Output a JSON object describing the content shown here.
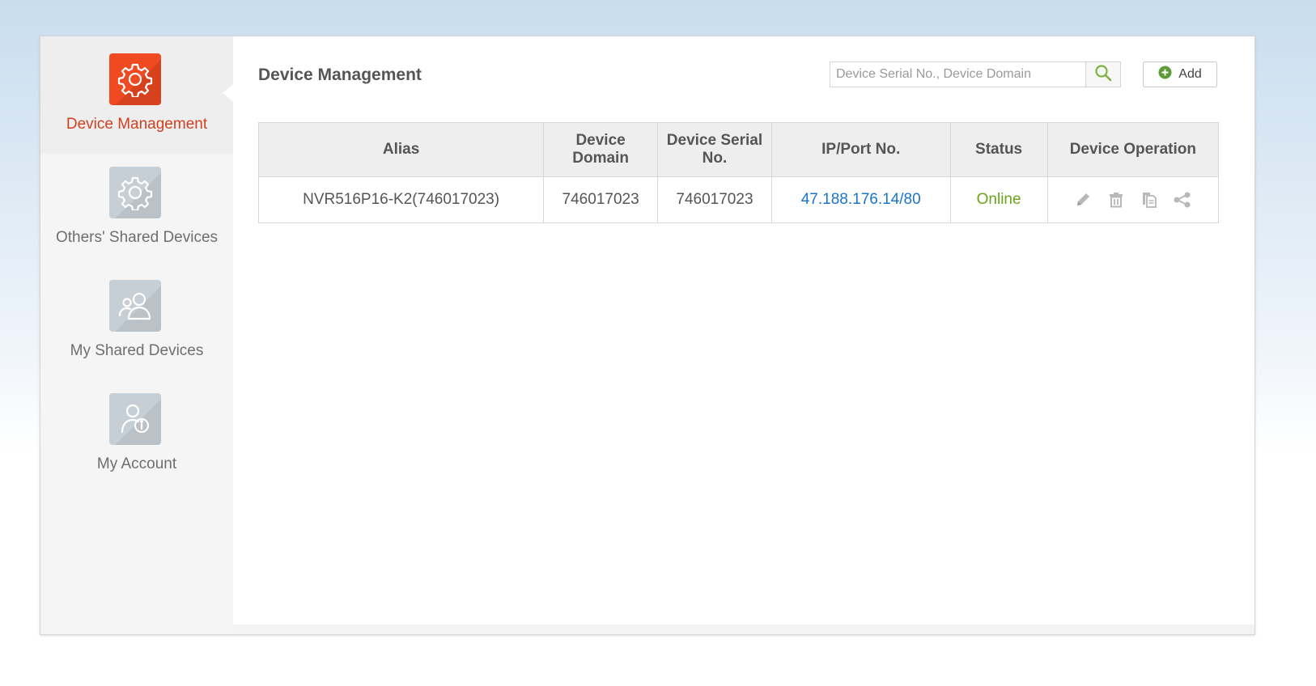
{
  "sidebar": {
    "items": [
      {
        "label": "Device Management",
        "icon": "gear-icon",
        "active": true
      },
      {
        "label": "Others' Shared Devices",
        "icon": "gear-icon",
        "active": false
      },
      {
        "label": "My Shared Devices",
        "icon": "users-icon",
        "active": false
      },
      {
        "label": "My Account",
        "icon": "user-info-icon",
        "active": false
      }
    ]
  },
  "main": {
    "title": "Device Management",
    "search": {
      "placeholder": "Device Serial No., Device Domain",
      "value": ""
    },
    "add_label": "Add",
    "table": {
      "columns": [
        "Alias",
        "Device Domain",
        "Device Serial No.",
        "IP/Port No.",
        "Status",
        "Device Operation"
      ],
      "rows": [
        {
          "alias": "NVR516P16-K2(746017023)",
          "domain": "746017023",
          "serial": "746017023",
          "ip_port": "47.188.176.14/80",
          "status": "Online",
          "operations": [
            "edit-icon",
            "delete-icon",
            "copy-icon",
            "share-icon"
          ]
        }
      ]
    }
  },
  "colors": {
    "accent": "#ef4a22",
    "active_label": "#d0411f",
    "link": "#1a74c8",
    "online": "#6aa31e",
    "icon_inactive": "#c6cfd5"
  }
}
